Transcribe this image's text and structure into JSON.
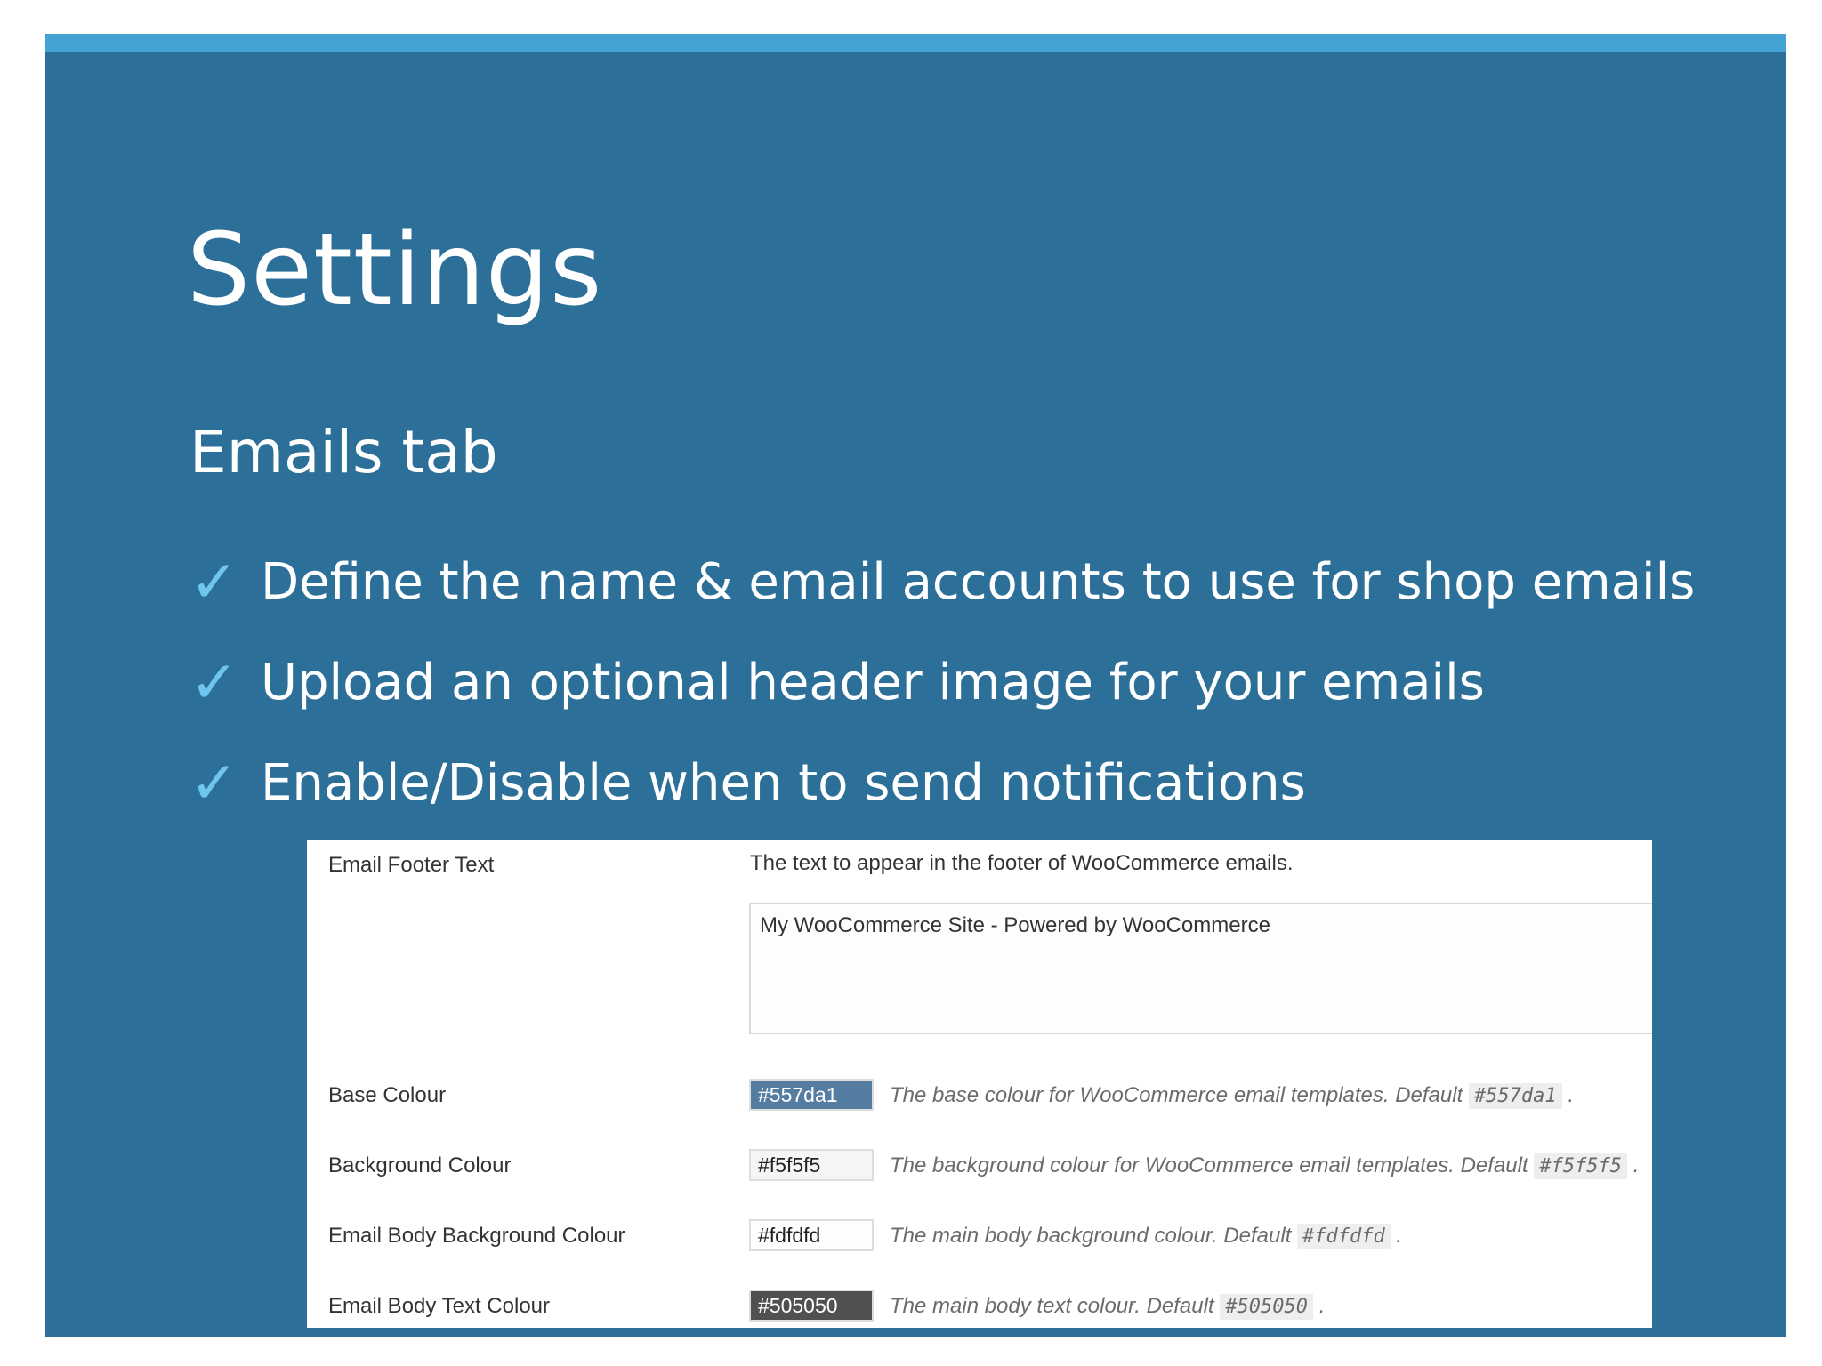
{
  "slide": {
    "title": "Settings",
    "subtitle": "Emails tab",
    "check_glyph": "✓",
    "bullets": [
      "Define the name & email accounts to use for shop emails",
      "Upload an optional header image for your emails",
      "Enable/Disable when to send notifications"
    ],
    "colors": {
      "background": "#2c6f99",
      "topbar": "#45a3d4",
      "check": "#6ec6ee"
    }
  },
  "settings": {
    "footer_text": {
      "label": "Email Footer Text",
      "help": "The text to appear in the footer of WooCommerce emails.",
      "value": "My WooCommerce Site - Powered by WooCommerce"
    },
    "rows": [
      {
        "label": "Base Colour",
        "value": "#557da1",
        "desc": "The base colour for WooCommerce email templates. Default",
        "default": "#557da1",
        "swatch": "#557da1",
        "text_color": "#ffffff"
      },
      {
        "label": "Background Colour",
        "value": "#f5f5f5",
        "desc": "The background colour for WooCommerce email templates. Default",
        "default": "#f5f5f5",
        "swatch": "#f5f5f5",
        "text_color": "#222222"
      },
      {
        "label": "Email Body Background Colour",
        "value": "#fdfdfd",
        "desc": "The main body background colour. Default",
        "default": "#fdfdfd",
        "swatch": "#fdfdfd",
        "text_color": "#222222"
      },
      {
        "label": "Email Body Text Colour",
        "value": "#505050",
        "desc": "The main body text colour. Default",
        "default": "#505050",
        "swatch": "#505050",
        "text_color": "#ffffff"
      }
    ]
  }
}
